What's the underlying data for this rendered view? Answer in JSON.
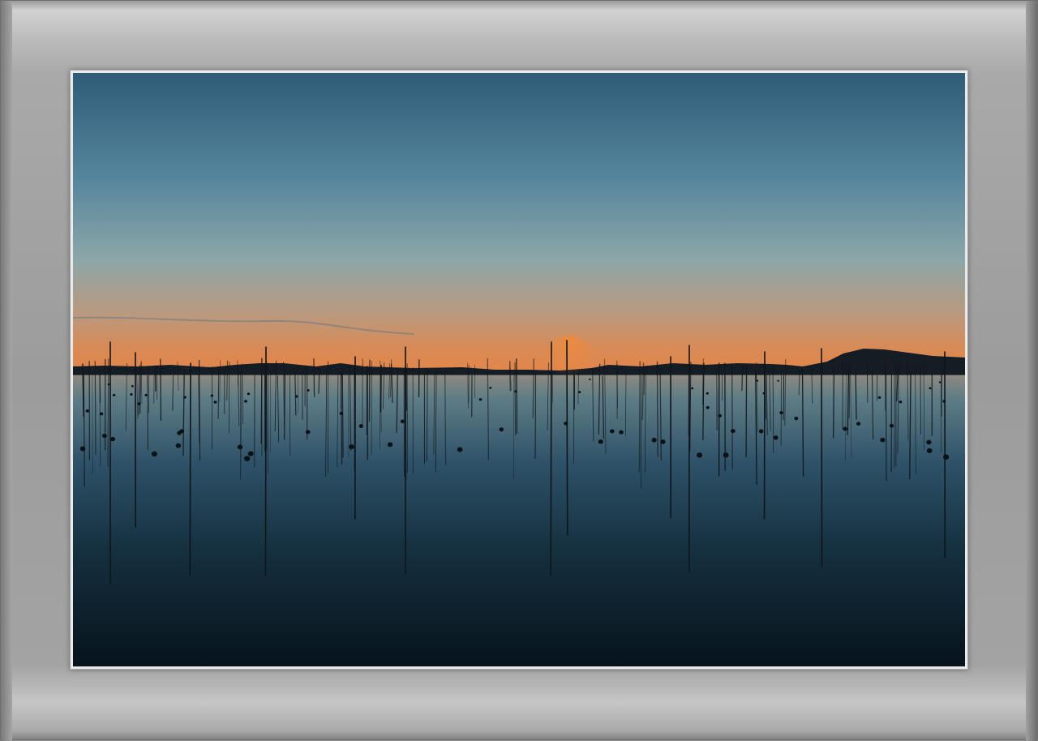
{
  "artwork": {
    "subject": "sunset-over-calm-water",
    "colors": {
      "sky_top": "#2f5b77",
      "sky_mid": "#6f98a9",
      "horizon_glow": "#f07a2a",
      "water_dark": "#07131c",
      "silhouette": "#111820",
      "frame_gray": "#9e9e9e"
    }
  }
}
